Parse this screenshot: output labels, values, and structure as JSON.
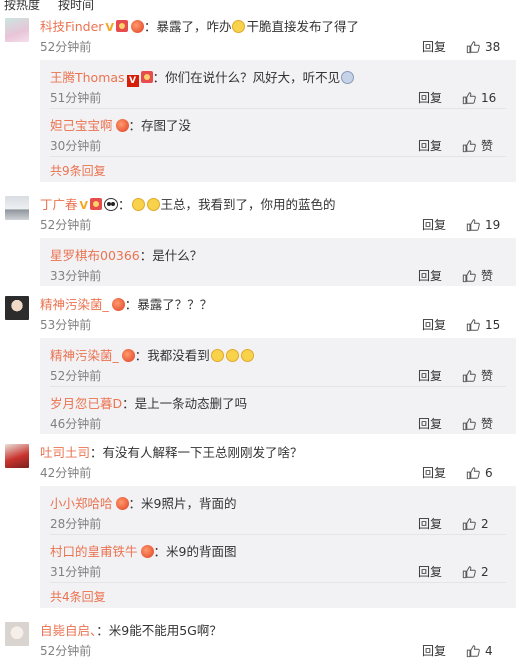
{
  "sort_tabs": {
    "hot": "按热度",
    "time": "按时间"
  },
  "labels": {
    "reply": "回复",
    "like": "赞"
  },
  "comments": [
    {
      "user": "科技Finder",
      "text": "：暴露了，咋办",
      "text2": "干脆直接发布了得了",
      "time": "52分钟前",
      "likes": "38",
      "replies": [
        {
          "user": "王腾Thomas",
          "text": "：你们在说什么？风好大，听不见",
          "time": "51分钟前",
          "likes": "16"
        },
        {
          "user": "妲己宝宝啊",
          "text": "：存图了没",
          "time": "30分钟前",
          "likes": ""
        }
      ],
      "more": "共9条回复"
    },
    {
      "user": "丁广春",
      "text": "王总，我看到了，你用的蓝色的",
      "time": "52分钟前",
      "likes": "19",
      "replies": [
        {
          "user": "星罗棋布00366",
          "text": "：是什么？",
          "time": "33分钟前",
          "likes": ""
        }
      ]
    },
    {
      "user": "精神污染菌_",
      "text": "：暴露了？？？",
      "time": "53分钟前",
      "likes": "15",
      "replies": [
        {
          "user": "精神污染菌_",
          "text": "：我都没看到",
          "time": "52分钟前",
          "likes": ""
        },
        {
          "user": "岁月忽已暮D",
          "text": "：是上一条动态删了吗",
          "time": "46分钟前",
          "likes": ""
        }
      ]
    },
    {
      "user": "吐司土司",
      "text": "：有没有人解释一下王总刚刚发了啥？",
      "time": "42分钟前",
      "likes": "6",
      "replies": [
        {
          "user": "小小郑哈哈",
          "text": "：米9照片，背面的",
          "time": "28分钟前",
          "likes": "2"
        },
        {
          "user": "村口的皇甫铁牛",
          "text": "：米9的背面图",
          "time": "31分钟前",
          "likes": "2"
        }
      ],
      "more": "共4条回复"
    },
    {
      "user": "自毙自启、",
      "text": "：米9能不能用5G啊？",
      "time": "52分钟前",
      "likes": "4"
    }
  ],
  "colors": {
    "username": "#eb7350",
    "time": "#808080",
    "reply_bg": "#f2f2f5",
    "page_bg": "#ffffff"
  }
}
